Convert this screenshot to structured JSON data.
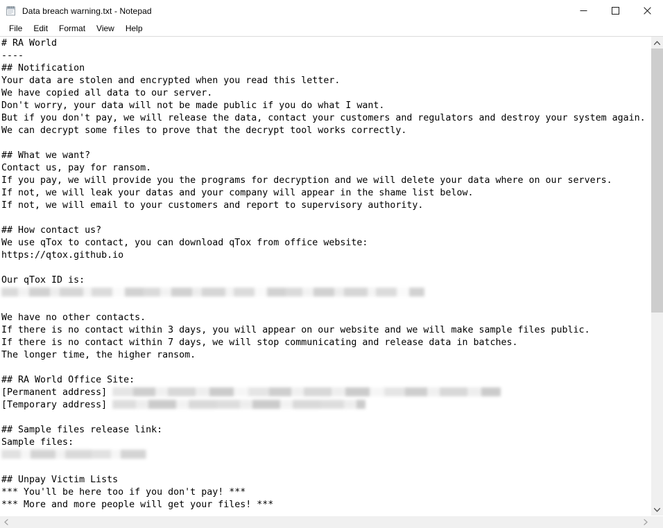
{
  "window": {
    "title": "Data breach warning.txt - Notepad",
    "icon": "notepad-icon",
    "controls": {
      "minimize": "─",
      "maximize": "□",
      "close": "✕"
    }
  },
  "menubar": {
    "items": [
      {
        "label": "File"
      },
      {
        "label": "Edit"
      },
      {
        "label": "Format"
      },
      {
        "label": "View"
      },
      {
        "label": "Help"
      }
    ]
  },
  "document": {
    "lines": [
      {
        "text": "# RA World"
      },
      {
        "text": "----"
      },
      {
        "text": "## Notification"
      },
      {
        "text": "Your data are stolen and encrypted when you read this letter."
      },
      {
        "text": "We have copied all data to our server."
      },
      {
        "text": "Don't worry, your data will not be made public if you do what I want."
      },
      {
        "text": "But if you don't pay, we will release the data, contact your customers and regulators and destroy your system again."
      },
      {
        "text": "We can decrypt some files to prove that the decrypt tool works correctly."
      },
      {
        "text": ""
      },
      {
        "text": "## What we want?"
      },
      {
        "text": "Contact us, pay for ransom."
      },
      {
        "text": "If you pay, we will provide you the programs for decryption and we will delete your data where on our servers."
      },
      {
        "text": "If not, we will leak your datas and your company will appear in the shame list below."
      },
      {
        "text": "If not, we will email to your customers and report to supervisory authority."
      },
      {
        "text": ""
      },
      {
        "text": "## How contact us?"
      },
      {
        "text": "We use qTox to contact, you can download qTox from office website:"
      },
      {
        "text": "https://qtox.github.io"
      },
      {
        "text": ""
      },
      {
        "text": "Our qTox ID is:"
      },
      {
        "text": "",
        "redacted": "r1"
      },
      {
        "text": ""
      },
      {
        "text": "We have no other contacts."
      },
      {
        "text": "If there is no contact within 3 days, you will appear on our website and we will make sample files public."
      },
      {
        "text": "If there is no contact within 7 days, we will stop communicating and release data in batches."
      },
      {
        "text": "The longer time, the higher ransom."
      },
      {
        "text": ""
      },
      {
        "text": "## RA World Office Site:"
      },
      {
        "text": "[Permanent address] ",
        "redacted": "r2"
      },
      {
        "text": "[Temporary address] ",
        "redacted": "r3"
      },
      {
        "text": ""
      },
      {
        "text": "## Sample files release link:"
      },
      {
        "text": "Sample files:"
      },
      {
        "text": "",
        "redacted": "r4"
      },
      {
        "text": ""
      },
      {
        "text": "## Unpay Victim Lists"
      },
      {
        "text": "*** You'll be here too if you don't pay! ***"
      },
      {
        "text": "*** More and more people will get your files! ***"
      }
    ]
  },
  "scrollbars": {
    "vertical": {
      "up_arrow": "▲",
      "down_arrow": "▼",
      "thumb_position_percent": 0,
      "thumb_size_percent": 58
    },
    "horizontal": {
      "left_arrow": "◀",
      "right_arrow": "▶"
    }
  },
  "colors": {
    "window_bg": "#ffffff",
    "text": "#000000",
    "scrollbar_track": "#f0f0f0",
    "scrollbar_thumb": "#cdcdcd",
    "close_hover": "#e81123"
  }
}
